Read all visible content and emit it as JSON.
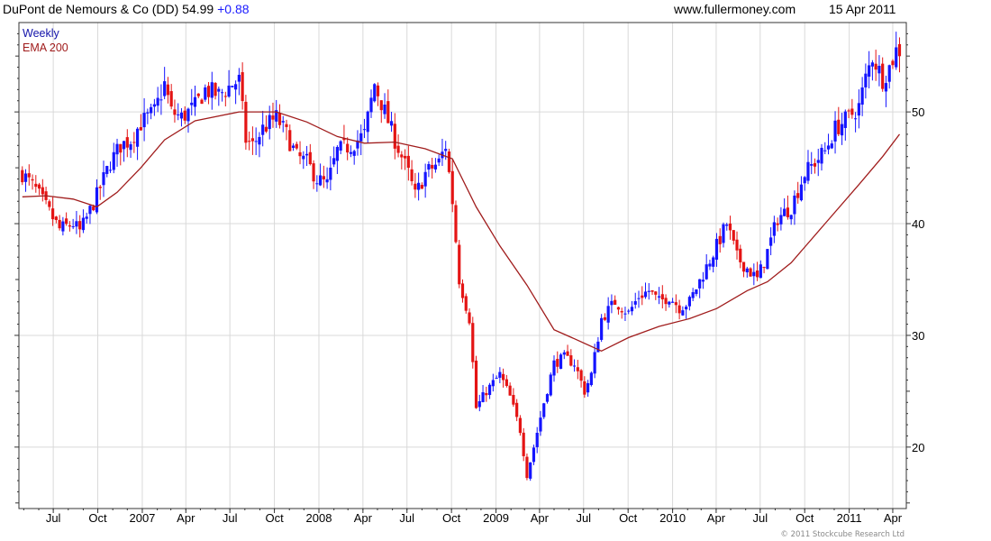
{
  "header": {
    "title": "DuPont de Nemours & Co (DD) 54.99",
    "change": "+0.88",
    "website": "www.fullermoney.com",
    "date": "15 Apr 2011"
  },
  "footer": {
    "copyright": "© 2011 Stockcube Research Ltd"
  },
  "colors": {
    "up": "#1414ff",
    "down": "#e41414",
    "ema": "#a01c1c",
    "grid": "#d9d9d9",
    "legend_weekly": "#1414aa",
    "legend_ema": "#a01c1c"
  },
  "chart_data": {
    "type": "candlestick",
    "title": "DuPont de Nemours & Co (DD) 54.99 +0.88",
    "legend": [
      "Weekly",
      "EMA 200"
    ],
    "legend_position": "top-left",
    "grid": true,
    "y_axis_side": "right",
    "ylim": [
      14.5,
      58
    ],
    "yticks": [
      20,
      30,
      40,
      50
    ],
    "x_tick_labels": [
      "Jul",
      "Oct",
      "2007",
      "Apr",
      "Jul",
      "Oct",
      "2008",
      "Apr",
      "Jul",
      "Oct",
      "2009",
      "Apr",
      "Jul",
      "Oct",
      "2010",
      "Apr",
      "Jul",
      "Oct",
      "2011",
      "Apr"
    ],
    "close_anchors": [
      [
        "2006-04-28",
        44.5
      ],
      [
        "2006-05-26",
        43.0
      ],
      [
        "2006-06-23",
        41.0
      ],
      [
        "2006-07-14",
        39.5
      ],
      [
        "2006-08-11",
        40.0
      ],
      [
        "2006-08-25",
        39.3
      ],
      [
        "2006-09-08",
        40.5
      ],
      [
        "2006-09-29",
        42.5
      ],
      [
        "2006-10-27",
        45.5
      ],
      [
        "2006-11-17",
        47.0
      ],
      [
        "2006-12-08",
        47.5
      ],
      [
        "2006-12-29",
        49.0
      ],
      [
        "2007-01-26",
        50.0
      ],
      [
        "2007-02-16",
        52.5
      ],
      [
        "2007-03-02",
        50.0
      ],
      [
        "2007-03-23",
        49.5
      ],
      [
        "2007-04-20",
        50.5
      ],
      [
        "2007-05-11",
        52.0
      ],
      [
        "2007-06-08",
        51.5
      ],
      [
        "2007-07-06",
        52.5
      ],
      [
        "2007-07-20",
        52.8
      ],
      [
        "2007-08-03",
        47.5
      ],
      [
        "2007-08-17",
        47.0
      ],
      [
        "2007-09-07",
        48.5
      ],
      [
        "2007-10-05",
        49.5
      ],
      [
        "2007-10-26",
        48.0
      ],
      [
        "2007-11-16",
        46.0
      ],
      [
        "2007-12-07",
        45.5
      ],
      [
        "2007-12-28",
        44.0
      ],
      [
        "2008-01-18",
        43.5
      ],
      [
        "2008-02-08",
        46.5
      ],
      [
        "2008-03-07",
        47.0
      ],
      [
        "2008-04-04",
        48.0
      ],
      [
        "2008-04-25",
        52.5
      ],
      [
        "2008-05-16",
        50.0
      ],
      [
        "2008-06-06",
        47.5
      ],
      [
        "2008-07-04",
        44.5
      ],
      [
        "2008-07-18",
        42.5
      ],
      [
        "2008-08-08",
        44.5
      ],
      [
        "2008-09-05",
        45.5
      ],
      [
        "2008-09-19",
        47.0
      ],
      [
        "2008-10-03",
        42.0
      ],
      [
        "2008-10-17",
        35.0
      ],
      [
        "2008-11-07",
        31.5
      ],
      [
        "2008-11-21",
        23.5
      ],
      [
        "2008-12-12",
        25.0
      ],
      [
        "2009-01-09",
        26.5
      ],
      [
        "2009-01-30",
        24.5
      ],
      [
        "2009-02-20",
        21.5
      ],
      [
        "2009-03-06",
        17.5
      ],
      [
        "2009-03-20",
        20.0
      ],
      [
        "2009-04-10",
        24.0
      ],
      [
        "2009-05-01",
        27.5
      ],
      [
        "2009-05-22",
        28.0
      ],
      [
        "2009-06-12",
        27.5
      ],
      [
        "2009-07-03",
        25.0
      ],
      [
        "2009-07-17",
        26.5
      ],
      [
        "2009-08-07",
        31.5
      ],
      [
        "2009-09-04",
        33.0
      ],
      [
        "2009-10-02",
        32.0
      ],
      [
        "2009-10-23",
        33.5
      ],
      [
        "2009-11-13",
        34.0
      ],
      [
        "2009-12-04",
        33.0
      ],
      [
        "2009-12-25",
        33.5
      ],
      [
        "2010-01-15",
        32.5
      ],
      [
        "2010-02-05",
        33.0
      ],
      [
        "2010-03-05",
        35.5
      ],
      [
        "2010-04-02",
        38.0
      ],
      [
        "2010-04-23",
        40.0
      ],
      [
        "2010-05-14",
        37.0
      ],
      [
        "2010-06-04",
        36.0
      ],
      [
        "2010-06-25",
        35.0
      ],
      [
        "2010-07-16",
        37.5
      ],
      [
        "2010-08-06",
        40.5
      ],
      [
        "2010-09-03",
        41.5
      ],
      [
        "2010-10-01",
        44.5
      ],
      [
        "2010-10-22",
        45.5
      ],
      [
        "2010-11-12",
        46.5
      ],
      [
        "2010-12-03",
        48.5
      ],
      [
        "2010-12-31",
        49.5
      ],
      [
        "2011-01-21",
        50.5
      ],
      [
        "2011-02-04",
        53.0
      ],
      [
        "2011-02-18",
        55.0
      ],
      [
        "2011-03-11",
        53.0
      ],
      [
        "2011-03-25",
        54.0
      ],
      [
        "2011-04-08",
        55.5
      ],
      [
        "2011-04-15",
        54.99
      ]
    ],
    "ema200_points": [
      [
        "2006-04-28",
        42.4
      ],
      [
        "2006-06-16",
        42.5
      ],
      [
        "2006-08-11",
        42.2
      ],
      [
        "2006-09-29",
        41.5
      ],
      [
        "2006-11-10",
        42.8
      ],
      [
        "2006-12-29",
        45.0
      ],
      [
        "2007-02-16",
        47.5
      ],
      [
        "2007-04-20",
        49.2
      ],
      [
        "2007-07-20",
        50.0
      ],
      [
        "2007-10-05",
        50.0
      ],
      [
        "2007-12-07",
        49.1
      ],
      [
        "2008-02-08",
        47.8
      ],
      [
        "2008-04-04",
        47.2
      ],
      [
        "2008-06-06",
        47.3
      ],
      [
        "2008-08-08",
        46.7
      ],
      [
        "2008-10-03",
        45.8
      ],
      [
        "2008-11-21",
        41.5
      ],
      [
        "2009-01-09",
        38.0
      ],
      [
        "2009-03-06",
        34.5
      ],
      [
        "2009-05-01",
        30.5
      ],
      [
        "2009-06-12",
        29.7
      ],
      [
        "2009-08-07",
        28.6
      ],
      [
        "2009-10-02",
        29.8
      ],
      [
        "2009-12-04",
        30.8
      ],
      [
        "2010-02-05",
        31.5
      ],
      [
        "2010-04-02",
        32.4
      ],
      [
        "2010-06-04",
        34.0
      ],
      [
        "2010-07-16",
        34.8
      ],
      [
        "2010-09-03",
        36.5
      ],
      [
        "2010-11-12",
        40.0
      ],
      [
        "2011-01-21",
        43.5
      ],
      [
        "2011-03-11",
        46.0
      ],
      [
        "2011-04-15",
        48.0
      ]
    ]
  }
}
